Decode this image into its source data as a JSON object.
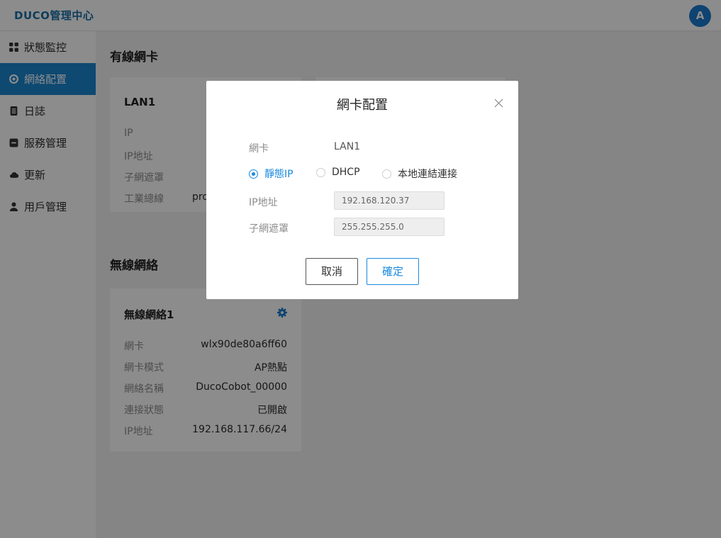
{
  "header": {
    "brand": "DUCO管理中心",
    "avatar_initial": "A"
  },
  "sidebar": {
    "items": [
      {
        "label": "狀態監控",
        "icon": "dashboard-icon"
      },
      {
        "label": "網絡配置",
        "icon": "network-icon",
        "active": true
      },
      {
        "label": "日誌",
        "icon": "log-icon"
      },
      {
        "label": "服務管理",
        "icon": "service-icon"
      },
      {
        "label": "更新",
        "icon": "cloud-icon"
      },
      {
        "label": "用戶管理",
        "icon": "user-icon"
      }
    ]
  },
  "wired": {
    "section_title": "有線網卡",
    "card": {
      "title": "LAN1",
      "rows": [
        {
          "label": "IP",
          "value": ""
        },
        {
          "label": "IP地址",
          "value": ""
        },
        {
          "label": "子網遮罩",
          "value": ""
        },
        {
          "label": "工業總線",
          "value": "pro"
        }
      ]
    }
  },
  "wireless": {
    "section_title": "無線網絡",
    "card": {
      "title": "無線網絡1",
      "rows": [
        {
          "label": "網卡",
          "value": "wlx90de80a6ff60"
        },
        {
          "label": "網卡模式",
          "value": "AP熱點"
        },
        {
          "label": "網絡名稱",
          "value": "DucoCobot_00000"
        },
        {
          "label": "連接狀態",
          "value": "已開啟"
        },
        {
          "label": "IP地址",
          "value": "192.168.117.66/24"
        }
      ]
    }
  },
  "modal": {
    "title": "網卡配置",
    "nic_label": "網卡",
    "nic_value": "LAN1",
    "radio_options": [
      {
        "label": "靜態IP",
        "checked": true
      },
      {
        "label": "DHCP",
        "checked": false
      },
      {
        "label": "本地連結連接",
        "checked": false
      }
    ],
    "ip_label": "IP地址",
    "ip_value": "192.168.120.37",
    "mask_label": "子網遮罩",
    "mask_value": "255.255.255.0",
    "cancel_label": "取消",
    "ok_label": "確定"
  },
  "colors": {
    "accent": "#1a8ae0",
    "sidebar_active": "#1b86cf",
    "brand": "#1a6fa8"
  }
}
